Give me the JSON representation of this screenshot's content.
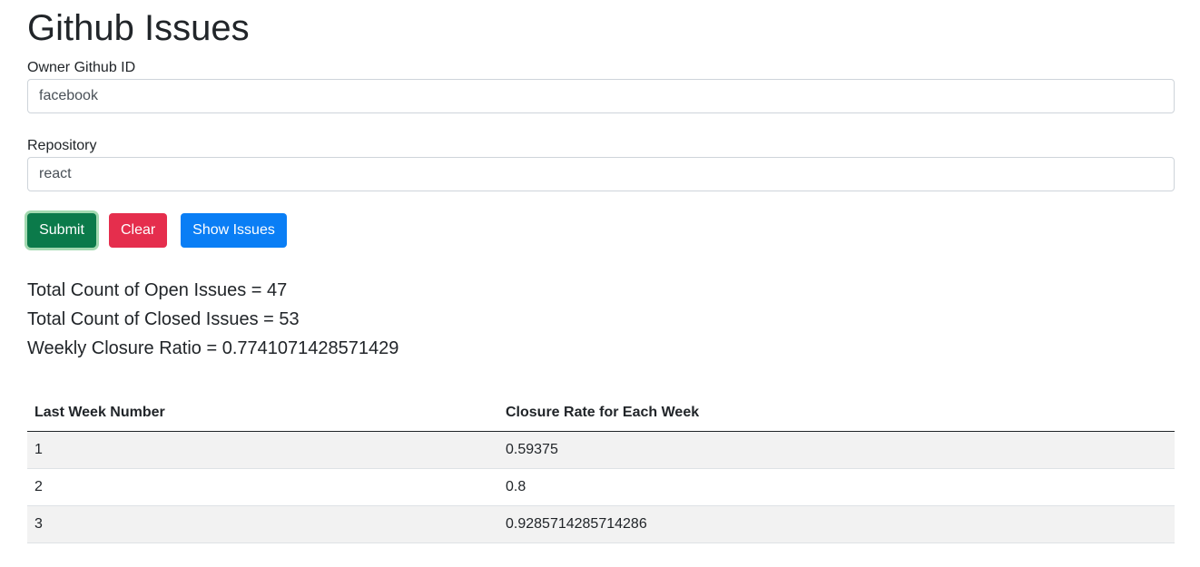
{
  "page": {
    "title": "Github Issues"
  },
  "form": {
    "owner_label": "Owner Github ID",
    "owner_value": "facebook",
    "repo_label": "Repository",
    "repo_value": "react"
  },
  "buttons": {
    "submit_label": "Submit",
    "clear_label": "Clear",
    "show_issues_label": "Show Issues"
  },
  "stats": {
    "open_issues": "Total Count of Open Issues = 47",
    "closed_issues": "Total Count of Closed Issues = 53",
    "closure_ratio": "Weekly Closure Ratio = 0.7741071428571429"
  },
  "table": {
    "headers": [
      "Last Week Number",
      "Closure Rate for Each Week"
    ],
    "rows": [
      [
        "1",
        "0.59375"
      ],
      [
        "2",
        "0.8"
      ],
      [
        "3",
        "0.9285714285714286"
      ]
    ]
  },
  "colors": {
    "submit": "#0b7a4a",
    "clear": "#e52e4d",
    "show_issues": "#0a7ef5"
  }
}
